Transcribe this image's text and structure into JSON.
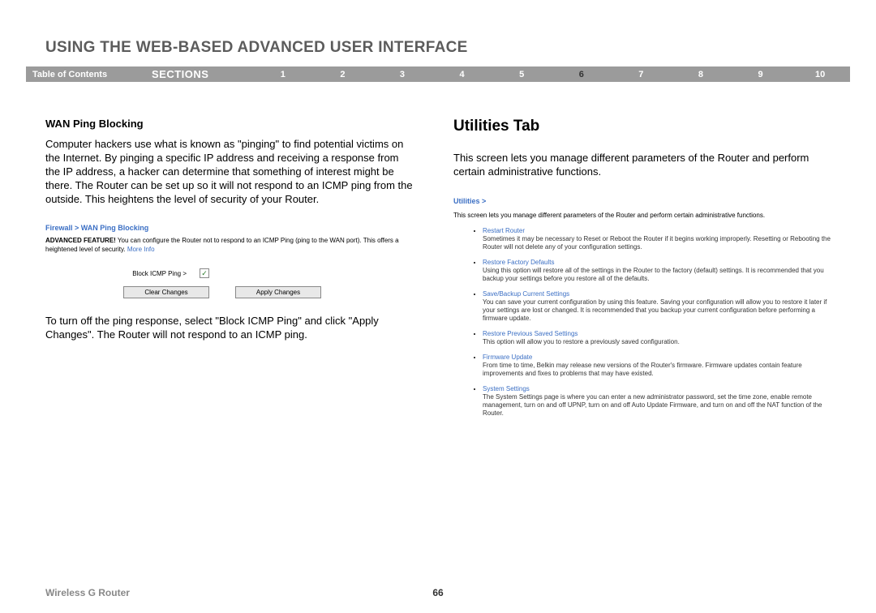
{
  "pageTitle": "USING THE WEB-BASED ADVANCED USER INTERFACE",
  "nav": {
    "toc": "Table of Contents",
    "sectionsLabel": "SECTIONS",
    "items": [
      "1",
      "2",
      "3",
      "4",
      "5",
      "6",
      "7",
      "8",
      "9",
      "10"
    ],
    "active": "6"
  },
  "left": {
    "heading": "WAN Ping Blocking",
    "p1": "Computer hackers use what is known as \"pinging\" to find potential victims on the Internet. By pinging a specific IP address and receiving a response from the IP address, a hacker can determine that something of interest might be there. The Router can be set up so it will not respond to an ICMP ping from the outside. This heightens the level of security of your Router.",
    "breadcrumb": "Firewall > WAN Ping Blocking",
    "advLabel": "ADVANCED FEATURE!",
    "advText": " You can configure the Router not to respond to an ICMP Ping (ping to the WAN port). This offers a heightened level of security. ",
    "moreInfo": "More Info",
    "blockLabel": "Block ICMP Ping >",
    "clearBtn": "Clear Changes",
    "applyBtn": "Apply Changes",
    "p2": "To turn off the ping response, select \"Block ICMP Ping\" and click \"Apply Changes\". The Router will not respond to an ICMP ping."
  },
  "right": {
    "heading": "Utilities Tab",
    "intro": "This screen lets you manage different parameters of the Router and perform certain administrative functions.",
    "utilLink": "Utilities >",
    "utilIntro": "This screen lets you manage different parameters of the Router and perform certain administrative functions.",
    "items": [
      {
        "title": "Restart Router",
        "desc": "Sometimes it may be necessary to Reset or Reboot the Router if it begins working improperly. Resetting or Rebooting the Router will not delete any of your configuration settings."
      },
      {
        "title": "Restore Factory Defaults",
        "desc": "Using this option will restore all of the settings in the Router to the factory (default) settings. It is recommended that you backup your settings before you restore all of the defaults."
      },
      {
        "title": "Save/Backup Current Settings",
        "desc": "You can save your current configuration by using this feature. Saving your configuration will allow you to restore it later if your settings are lost or changed. It is recommended that you backup your current configuration before performing a firmware update."
      },
      {
        "title": "Restore Previous Saved Settings",
        "desc": "This option will allow you to restore a previously saved configuration."
      },
      {
        "title": "Firmware Update",
        "desc": "From time to time, Belkin may release new versions of the Router's firmware. Firmware updates contain feature improvements and fixes to problems that may have existed."
      },
      {
        "title": "System Settings",
        "desc": "The System Settings page is where you can enter a new administrator password, set the time zone, enable remote management, turn on and off UPNP, turn on and off Auto Update Firmware, and turn on and off the NAT function of the Router."
      }
    ]
  },
  "footer": {
    "product": "Wireless G Router",
    "page": "66"
  }
}
